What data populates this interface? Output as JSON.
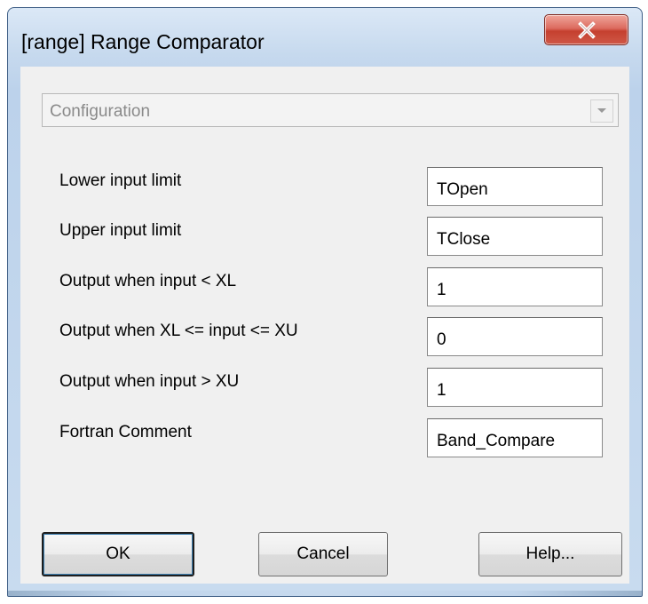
{
  "window": {
    "title": "[range] Range Comparator",
    "close_label": "X"
  },
  "config": {
    "selected": "Configuration"
  },
  "fields": [
    {
      "label": "Lower input limit",
      "value": "TOpen"
    },
    {
      "label": "Upper input limit",
      "value": "TClose"
    },
    {
      "label": "Output when input < XL",
      "value": "1"
    },
    {
      "label": "Output when XL <= input <= XU",
      "value": "0"
    },
    {
      "label": "Output when input > XU",
      "value": "1"
    },
    {
      "label": "Fortran Comment",
      "value": "Band_Compare"
    }
  ],
  "buttons": {
    "ok": "OK",
    "cancel": "Cancel",
    "help": "Help..."
  }
}
